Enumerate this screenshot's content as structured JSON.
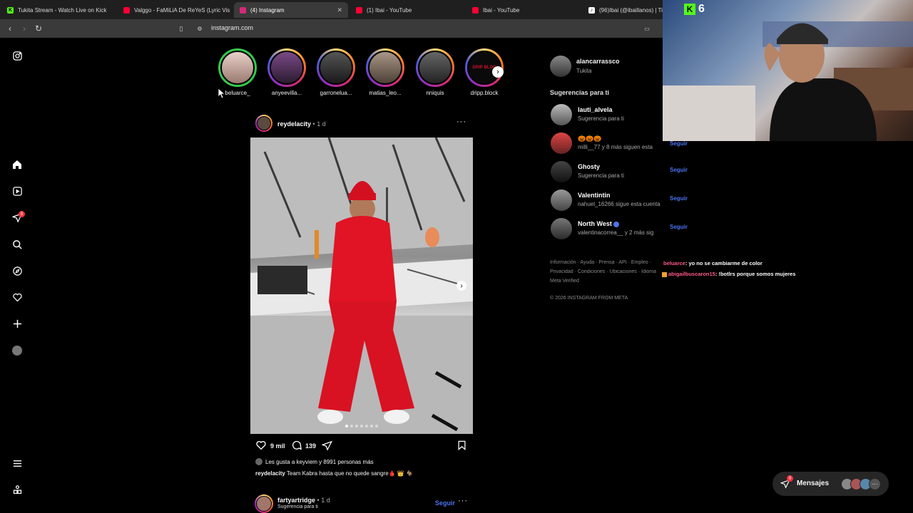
{
  "browser": {
    "tabs": [
      {
        "title": "Tukita Stream - Watch Live on Kick",
        "favicon": "kick-icon",
        "color": "#53fc18"
      },
      {
        "title": "Valggo - FaMiLiA De ReYeS (Lyric Vis",
        "favicon": "youtube-icon",
        "color": "#ff0033"
      },
      {
        "title": "(4) Instagram",
        "favicon": "instagram-icon",
        "color": "#d62976",
        "active": true
      },
      {
        "title": "(1) Ibai - YouTube",
        "favicon": "youtube-icon",
        "color": "#ff0033"
      },
      {
        "title": "Ibai - YouTube",
        "favicon": "youtube-icon",
        "color": "#ff0033"
      },
      {
        "title": "(96)Ibai (@ibaillanos) | Tik",
        "favicon": "tiktok-icon",
        "color": "#ffffff"
      }
    ],
    "url": "instagram.com"
  },
  "sidenav": {
    "notification_count": "5"
  },
  "stories": [
    {
      "username": "beluarce_",
      "close_friend": true,
      "color": "#caa"
    },
    {
      "username": "anyeevilla...",
      "color": "#5b3b66"
    },
    {
      "username": "garronelua...",
      "color": "#3b3b3b"
    },
    {
      "username": "matias_leo...",
      "color": "#8a7a6a"
    },
    {
      "username": "nniquis",
      "color": "#4a4a4a"
    },
    {
      "username": "dripp.block",
      "color": "#b00010",
      "pic_text": "DRIP BLOC"
    }
  ],
  "post": {
    "username": "reydelacity",
    "time": "1 d",
    "likes": "9 mil",
    "comments": "139",
    "liked_by": "Les gusta a keyviem y 8991 personas más",
    "caption": "Team Kabra hasta que no quede sangre🩸 👑 🐐"
  },
  "next_post": {
    "username": "fartyartridge",
    "time": "1 d",
    "subtitle": "Sugerencia para ti",
    "follow": "Seguir"
  },
  "profile": {
    "username": "alancarrassco",
    "name": "Tukita"
  },
  "suggestions_title": "Sugerencias para ti",
  "suggestions": [
    {
      "name": "lauti_alvela",
      "sub": "Sugerencia para ti",
      "follow": ""
    },
    {
      "name": "🎃🎃🎃",
      "sub": "milli__77 y 8 más siguen esta",
      "follow": "Seguir"
    },
    {
      "name": "Ghosty",
      "sub": "Sugerencia para ti",
      "follow": "Seguir"
    },
    {
      "name": "Valentintin",
      "sub": "nahuel_16266 sigue esta cuenta",
      "follow": "Seguir"
    },
    {
      "name": "North West",
      "sub": "valentinacorrea__ y 2 más sig",
      "follow": "Seguir",
      "verified": true
    }
  ],
  "footer": {
    "line1": "Información · Ayuda · Prensa · API · Empleo ·",
    "line2": "Privacidad · Condiciones · Ubicaciones · Idioma",
    "line3": "Meta Verified",
    "copyright": "© 2026 INSTAGRAM FROM META"
  },
  "chat_overlay": [
    {
      "user": "beluarce",
      "text": ": yo no se cambiarme de color"
    },
    {
      "user": "abigailbuscaron15",
      "text": ": !botlrs porque somos mujeres"
    }
  ],
  "messages": {
    "label": "Mensajes",
    "count": "9"
  },
  "stream": {
    "kick_count": "6"
  }
}
